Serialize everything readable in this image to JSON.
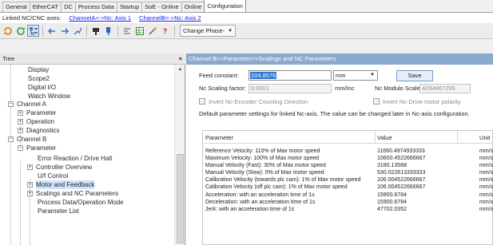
{
  "tabs": [
    "General",
    "EtherCAT",
    "DC",
    "Process Data",
    "Startup",
    "SoE - Online",
    "Online",
    "Configuration"
  ],
  "linked": {
    "label": "Linked NC/CNC axes:",
    "channel_a": "ChannelA<->Nc: Axis 1",
    "channel_b": "ChannelB<->Nc: Axis 2"
  },
  "toolbar": {
    "icons": [
      "refresh-icon",
      "refresh-green-icon",
      "tree-view-icon",
      "arrow-left-icon",
      "arrow-right-icon",
      "link-icon",
      "pin-icon",
      "pin-blue-icon",
      "align-icon",
      "table-icon",
      "wand-icon",
      "help-icon"
    ],
    "phase_label": "Change Phase-"
  },
  "tree": {
    "title": "Tree",
    "close": "×",
    "items": [
      "Display",
      "Scope2",
      "Digital I/O",
      "Watch Window",
      "Channel A",
      "Parameter",
      "Operation",
      "Diagnostics",
      "Channel B",
      "Parameter",
      "Error Reaction / Drive Halt",
      "Controller Overview",
      "U/f Control",
      "Motor and Feedback",
      "Scalings and NC Parameters",
      "Process Data/Operation Mode",
      "Parameter List"
    ]
  },
  "detail": {
    "crumb": "Channel B>>Parameter>>Scalings and NC Parameters",
    "feed_label": "Feed constant:",
    "feed_value": "104.8576",
    "unit": "mm",
    "save": "Save",
    "nc_label": "Nc Scaling factor:",
    "nc_value": "0.0001",
    "nc_unit": "mm/Inc",
    "modulo_label": "Nc Modulo Scale:",
    "modulo_value": "4294967295",
    "invert_encoder": "Invert Nc-Encoder Counting Direction",
    "invert_polarity": "Invert Nc-Drive motor polarity",
    "note": "Default parameter settings for linked Nc-axis. The value can be changed later in Nc-axis configuration."
  },
  "table": {
    "headers": [
      "Parameter",
      "Value",
      "Unit"
    ],
    "rows": [
      [
        "Reference Velocity: 110% of Max motor speed",
        "11660.4974933333",
        "mm/s"
      ],
      [
        "Maximum Velocity: 100% of Max motor speed",
        "10600.4522666667",
        "mm/s"
      ],
      [
        "Manual Velocity (Fast): 30% of Max motor speed",
        "3180.13568",
        "mm/s"
      ],
      [
        "Manual Velocity (Slow): 5% of Max motor speed",
        "530.022613333333",
        "mm/s"
      ],
      [
        "Calibration Velocity (towards plc cam): 1% of Max motor speed",
        "106.004522666667",
        "mm/s"
      ],
      [
        "Calibration Velocity (off plc cam): 1% of Max motor speed",
        "106.004522666667",
        "mm/s"
      ],
      [
        "Acceleration: with an acceleration time of 1s",
        "15900.6784",
        "mm/s2"
      ],
      [
        "Deceleration: with an acceleration time of 1s",
        "15900.6784",
        "mm/s2"
      ],
      [
        "Jerk: with an acceleration time of 1s",
        "47702.0352",
        "mm/s3"
      ]
    ]
  }
}
